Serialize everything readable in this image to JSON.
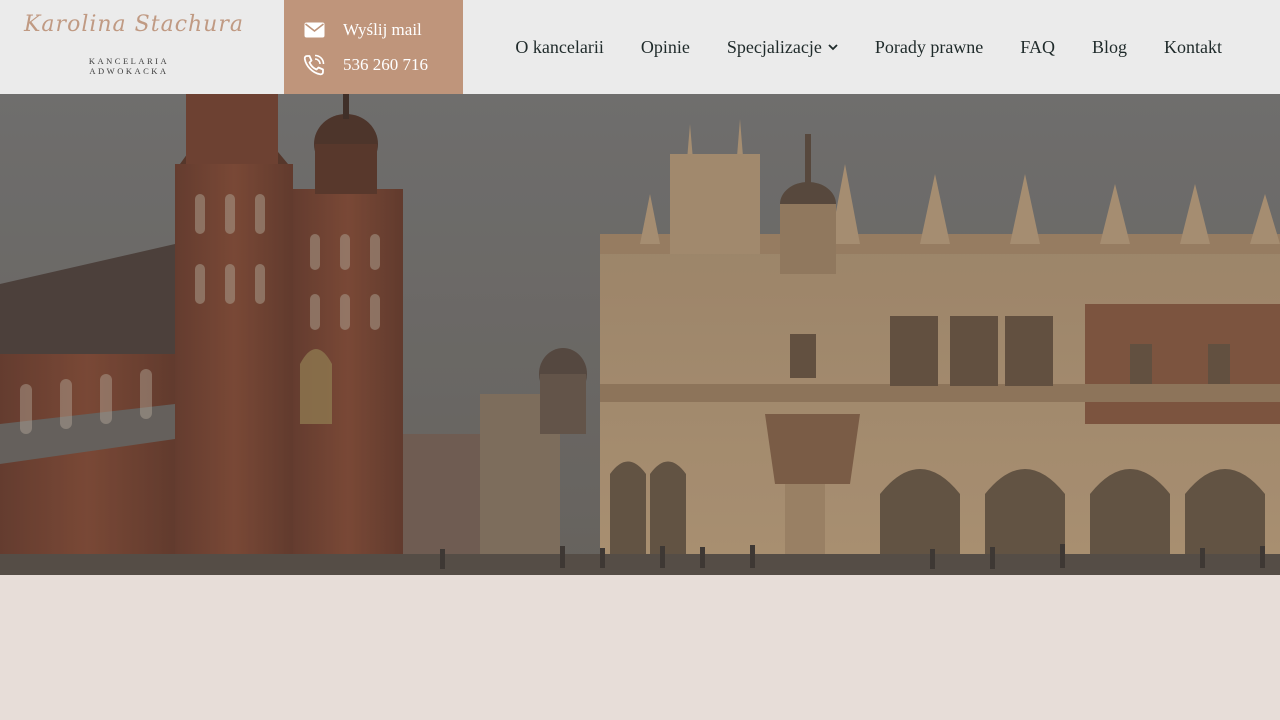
{
  "brand": {
    "script_name": "Karolina Stachura",
    "subtitle_line1": "KANCELARIA",
    "subtitle_line2": "ADWOKACKA"
  },
  "contact": {
    "email_label": "Wyślij mail",
    "phone_label": "536 260 716",
    "email_icon": "envelope-icon",
    "phone_icon": "phone-icon"
  },
  "nav": {
    "items": [
      {
        "label": "O kancelarii"
      },
      {
        "label": "Opinie"
      },
      {
        "label": "Specjalizacje",
        "has_dropdown": true
      },
      {
        "label": "Porady prawne"
      },
      {
        "label": "FAQ"
      },
      {
        "label": "Blog"
      },
      {
        "label": "Kontakt"
      }
    ]
  },
  "colors": {
    "header_bg": "#ebebeb",
    "accent": "#bf957b",
    "nav_text": "#1f2a2a",
    "page_bg": "#e7ddd8"
  }
}
